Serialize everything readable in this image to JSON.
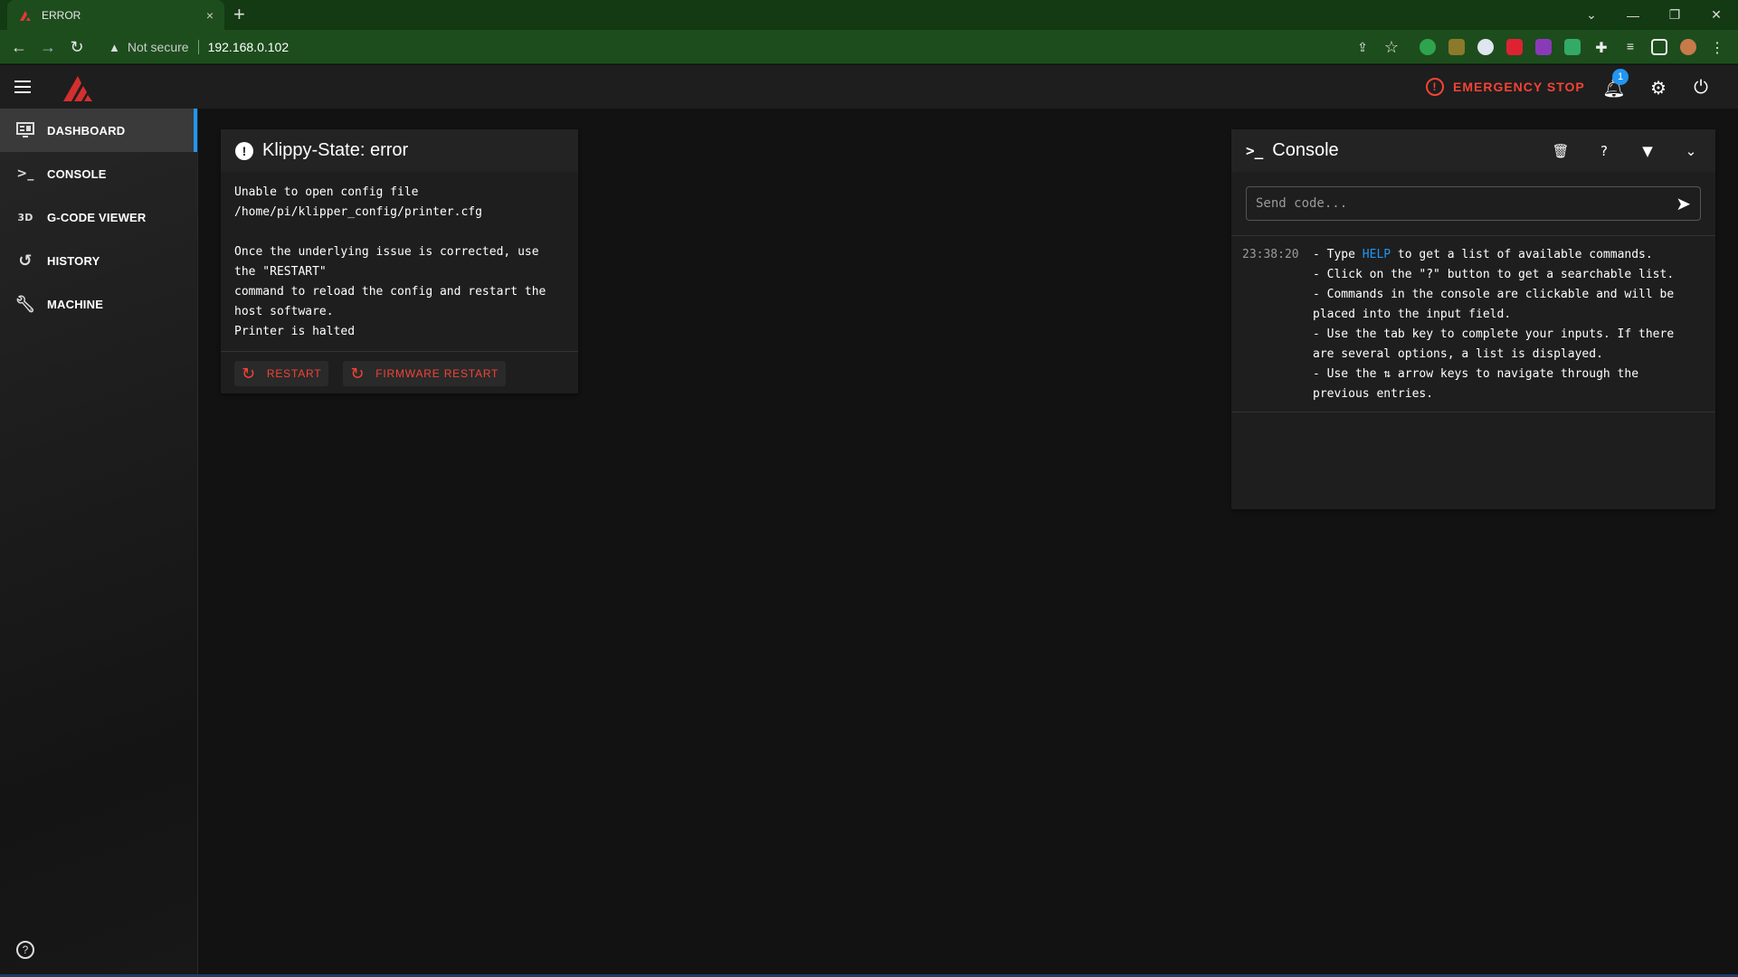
{
  "browser": {
    "tab_title": "ERROR",
    "tab_close": "×",
    "new_tab": "+",
    "security_label": "Not secure",
    "url": "192.168.0.102",
    "colors": {
      "frame": "#133a13",
      "toolbar": "#1d4d1d"
    }
  },
  "header": {
    "emergency_stop": "EMERGENCY STOP",
    "notification_count": "1",
    "accent": "#f44336"
  },
  "sidebar": {
    "items": [
      {
        "label": "DASHBOARD",
        "icon": "monitor-dashboard-icon"
      },
      {
        "label": "CONSOLE",
        "icon": "console-icon"
      },
      {
        "label": "G-CODE VIEWER",
        "icon": "3d-icon"
      },
      {
        "label": "HISTORY",
        "icon": "history-icon"
      },
      {
        "label": "MACHINE",
        "icon": "wrench-icon"
      }
    ],
    "icon_glyphs": {
      "console": ">_",
      "viewer": "3D"
    }
  },
  "klippy": {
    "title": "Klippy-State: error",
    "message": "Unable to open config file\n/home/pi/klipper_config/printer.cfg\n\nOnce the underlying issue is corrected, use\nthe \"RESTART\"\ncommand to reload the config and restart the\nhost software.\nPrinter is halted",
    "restart_label": "RESTART",
    "firmware_restart_label": "FIRMWARE RESTART"
  },
  "console": {
    "title": "Console",
    "title_glyph": ">_",
    "input_placeholder": "Send code...",
    "timestamp": "23:38:20",
    "line1_pre": "- Type ",
    "line1_kw": "HELP",
    "line1_post": " to get a list of available commands.",
    "line2": "- Click on the \"?\" button to get a searchable list.",
    "line3": "- Commands in the console are clickable and will be",
    "line4": "placed into the input field.",
    "line5": "- Use the tab key to complete your inputs. If there",
    "line6": "are several options, a list is displayed.",
    "line7": "- Use the ⇅ arrow keys to navigate through the",
    "line8": "previous entries."
  }
}
